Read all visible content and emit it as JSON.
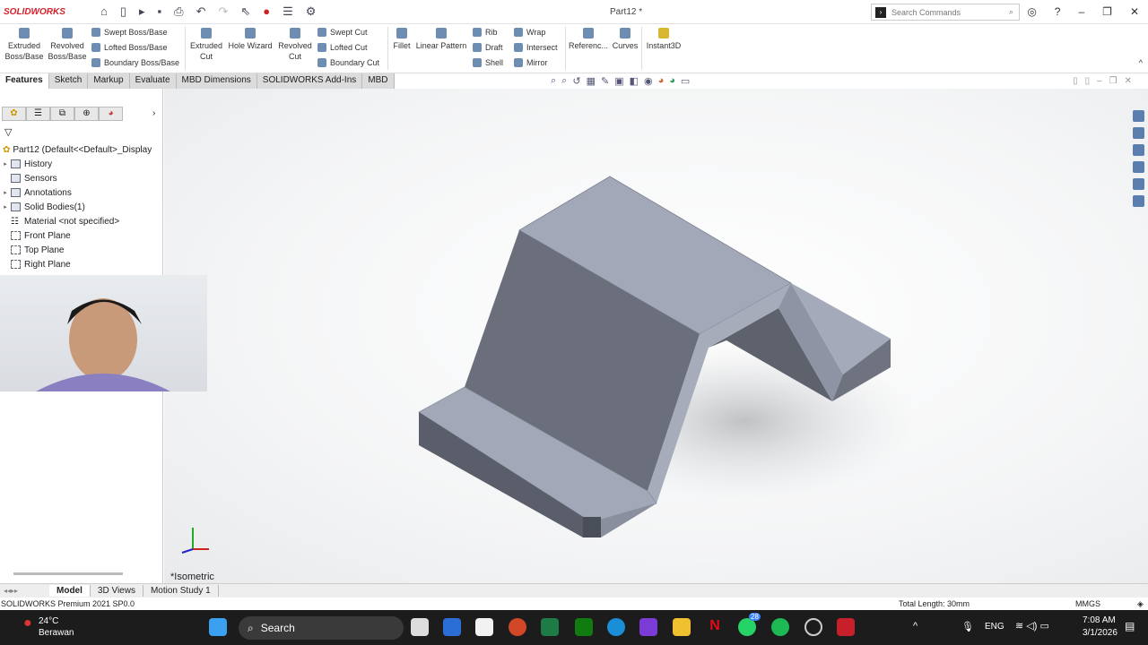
{
  "app": {
    "logo": "SOLIDWORKS",
    "doc_title": "Part12 *",
    "search_placeholder": "Search Commands"
  },
  "ribbon": {
    "big": [
      "Extruded Boss/Base",
      "Revolved Boss/Base",
      "Extruded Cut",
      "Hole Wizard",
      "Revolved Cut",
      "Fillet",
      "Linear Pattern",
      "Referenc...",
      "Curves",
      "Instant3D"
    ],
    "small": [
      "Swept Boss/Base",
      "Lofted Boss/Base",
      "Boundary Boss/Base",
      "Swept Cut",
      "Lofted Cut",
      "Boundary Cut",
      "Rib",
      "Draft",
      "Shell",
      "Wrap",
      "Intersect",
      "Mirror"
    ]
  },
  "tabs": [
    "Features",
    "Sketch",
    "Markup",
    "Evaluate",
    "MBD Dimensions",
    "SOLIDWORKS Add-Ins",
    "MBD"
  ],
  "tree": {
    "root": "Part12  (Default<<Default>_Display",
    "items": [
      "History",
      "Sensors",
      "Annotations",
      "Solid Bodies(1)",
      "Material <not specified>",
      "Front Plane",
      "Top Plane",
      "Right Plane"
    ]
  },
  "viewport": {
    "view_label": "*Isometric"
  },
  "bottom_tabs": [
    "Model",
    "3D Views",
    "Motion Study 1"
  ],
  "status": {
    "version": "SOLIDWORKS Premium 2021 SP0.0",
    "measure": "Total Length: 30mm",
    "units": "MMGS"
  },
  "taskbar": {
    "temp": "24°C",
    "weather": "Berawan",
    "search": "Search",
    "lang": "ENG",
    "time": "7:08 AM",
    "date": "3/1/2026",
    "badge": "28"
  },
  "colors": {
    "accent": "#d4202a",
    "face_light": "#a3a8b8",
    "face_dark": "#6b6f7c"
  }
}
